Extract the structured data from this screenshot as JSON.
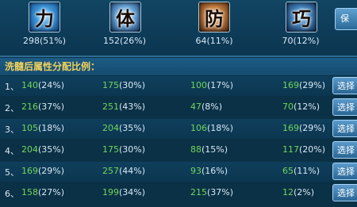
{
  "stats": [
    {
      "name": "力",
      "icon": "strength-icon",
      "value": "298(51%)"
    },
    {
      "name": "体",
      "icon": "constitution-icon",
      "value": "152(26%)"
    },
    {
      "name": "防",
      "icon": "defense-icon",
      "value": "64(11%)"
    },
    {
      "name": "巧",
      "icon": "agility-icon",
      "value": "70(12%)"
    }
  ],
  "save_label": "保",
  "subtitle": "洗髓后属性分配比例：",
  "select_label": "选择",
  "rows": [
    {
      "idx": "1、",
      "c": [
        [
          "140",
          "(24%)"
        ],
        [
          "175",
          "(30%)"
        ],
        [
          "100",
          "(17%)"
        ],
        [
          "169",
          "(29%)"
        ]
      ]
    },
    {
      "idx": "2、",
      "c": [
        [
          "216",
          "(37%)"
        ],
        [
          "251",
          "(43%)"
        ],
        [
          "47",
          "(8%)"
        ],
        [
          "70",
          "(12%)"
        ]
      ]
    },
    {
      "idx": "3、",
      "c": [
        [
          "105",
          "(18%)"
        ],
        [
          "204",
          "(35%)"
        ],
        [
          "106",
          "(18%)"
        ],
        [
          "169",
          "(29%)"
        ]
      ]
    },
    {
      "idx": "4、",
      "c": [
        [
          "204",
          "(35%)"
        ],
        [
          "175",
          "(30%)"
        ],
        [
          "88",
          "(15%)"
        ],
        [
          "117",
          "(20%)"
        ]
      ]
    },
    {
      "idx": "5、",
      "c": [
        [
          "169",
          "(29%)"
        ],
        [
          "257",
          "(44%)"
        ],
        [
          "93",
          "(16%)"
        ],
        [
          "65",
          "(11%)"
        ]
      ]
    },
    {
      "idx": "6、",
      "c": [
        [
          "158",
          "(27%)"
        ],
        [
          "199",
          "(34%)"
        ],
        [
          "215",
          "(37%)"
        ],
        [
          "12",
          "(2%)"
        ]
      ]
    }
  ]
}
